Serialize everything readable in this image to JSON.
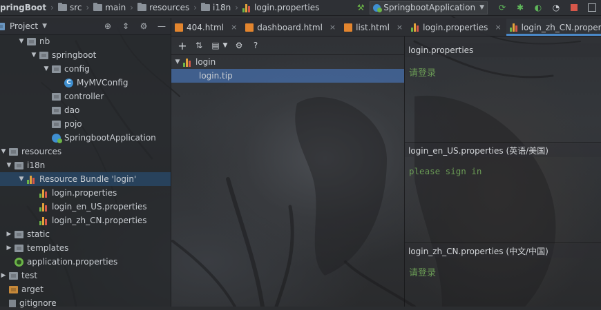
{
  "breadcrumb": {
    "items": [
      "pringBoot",
      "src",
      "main",
      "resources",
      "i18n",
      "login.properties"
    ]
  },
  "run_config": {
    "name": "SpringbootApplication"
  },
  "toolbar_icons": [
    "hammer-icon",
    "run-icon",
    "debug-icon",
    "coverage-icon",
    "profile-icon",
    "stop-icon",
    "frame-icon"
  ],
  "project_panel": {
    "title": "Project",
    "tools": [
      "target-icon",
      "collapse-icon",
      "gear-icon",
      "minimize-icon"
    ]
  },
  "tree": [
    {
      "label": "nb",
      "indent": 2,
      "expanded": true,
      "icon": "folder"
    },
    {
      "label": "springboot",
      "indent": 3,
      "expanded": true,
      "icon": "folder"
    },
    {
      "label": "config",
      "indent": 4,
      "expanded": true,
      "icon": "folder"
    },
    {
      "label": "MyMVConfig",
      "indent": 5,
      "icon": "class"
    },
    {
      "label": "controller",
      "indent": 4,
      "icon": "folder"
    },
    {
      "label": "dao",
      "indent": 4,
      "icon": "folder"
    },
    {
      "label": "pojo",
      "indent": 4,
      "icon": "folder"
    },
    {
      "label": "SpringbootApplication",
      "indent": 4,
      "icon": "app"
    },
    {
      "label": "resources",
      "indent": 0,
      "expanded": true,
      "icon": "folder"
    },
    {
      "label": "i18n",
      "indent": 1,
      "expanded": true,
      "icon": "folder"
    },
    {
      "label": "Resource Bundle 'login'",
      "indent": 2,
      "expanded": true,
      "icon": "bundle",
      "selected": true
    },
    {
      "label": "login.properties",
      "indent": 3,
      "icon": "bundle"
    },
    {
      "label": "login_en_US.properties",
      "indent": 3,
      "icon": "bundle"
    },
    {
      "label": "login_zh_CN.properties",
      "indent": 3,
      "icon": "bundle"
    },
    {
      "label": "static",
      "indent": 1,
      "expanded": false,
      "icon": "folder"
    },
    {
      "label": "templates",
      "indent": 1,
      "expanded": false,
      "icon": "folder"
    },
    {
      "label": "application.properties",
      "indent": 1,
      "icon": "spring"
    },
    {
      "label": "test",
      "indent": 0,
      "expanded": false,
      "icon": "folder"
    },
    {
      "label": "arget",
      "indent": 0,
      "icon": "folder-orange"
    },
    {
      "label": "gitignore",
      "indent": 0,
      "icon": "file"
    }
  ],
  "tabs": [
    {
      "label": "404.html",
      "icon": "html",
      "active": false
    },
    {
      "label": "dashboard.html",
      "icon": "html",
      "active": false
    },
    {
      "label": "list.html",
      "icon": "html",
      "active": false
    },
    {
      "label": "login.properties",
      "icon": "bundle",
      "active": false
    },
    {
      "label": "login_zh_CN.properties",
      "icon": "bundle",
      "active": true
    }
  ],
  "bundle_toolbar": [
    "add-icon",
    "sort-icon",
    "group-icon",
    "gear-icon",
    "help-icon"
  ],
  "bundle_tree": {
    "root": "login",
    "keys": [
      "login.tip"
    ]
  },
  "panes": [
    {
      "header": "login.properties",
      "value": "请登录"
    },
    {
      "header": "login_en_US.properties (英语/美国)",
      "value": "please sign in"
    },
    {
      "header": "login_zh_CN.properties (中文/中国)",
      "value": "请登录"
    }
  ],
  "colors": {
    "accent": "#4a88c7",
    "value_green": "#6a9a55",
    "selection": "#466eaa"
  }
}
